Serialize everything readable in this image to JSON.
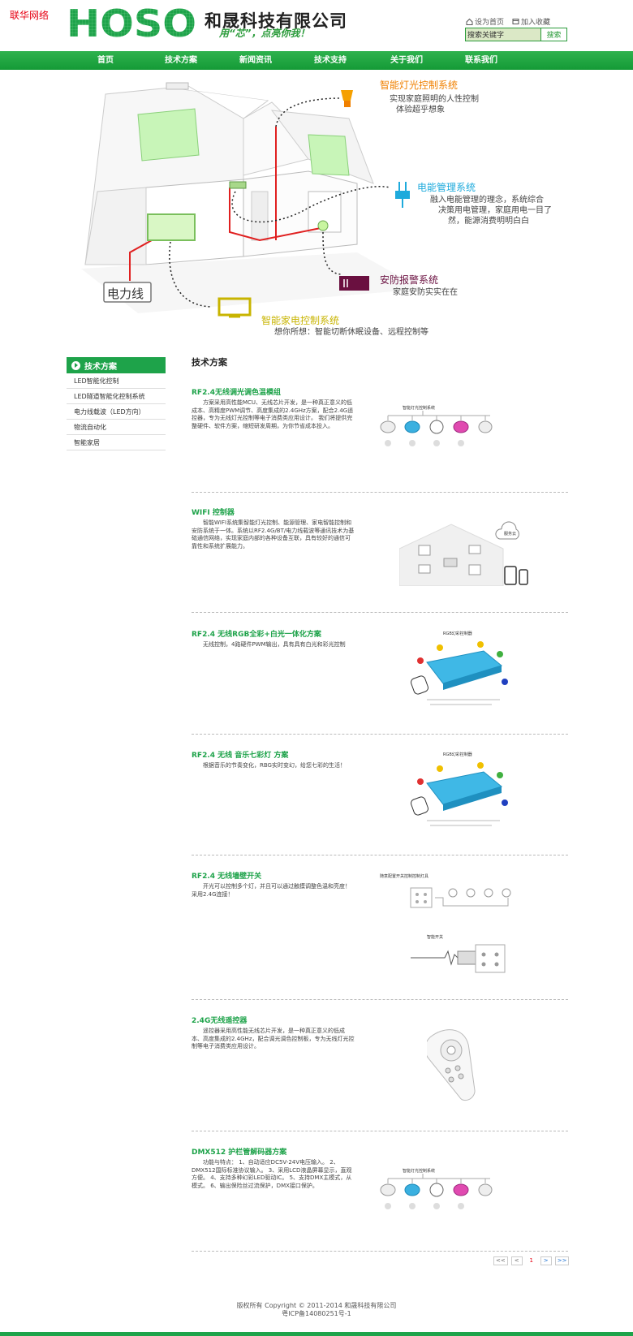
{
  "corner_link": "联华网络",
  "header": {
    "logo_text": "HOSO",
    "company_name": "和晟科技有限公司",
    "slogan": "用“芯”，点亮你我！",
    "set_home": "设为首页",
    "add_favorite": "加入收藏",
    "search_value": "搜索关键字",
    "search_button": "搜索",
    "brand_green": "#1ea34a"
  },
  "nav": [
    "首页",
    "技术方案",
    "新闻资讯",
    "技术支持",
    "关于我们",
    "联系我们"
  ],
  "banner": {
    "power_line": "电力线",
    "lighting": {
      "title": "智能灯光控制系统",
      "lines": [
        "实现家庭照明的人性控制",
        "体验超乎想象"
      ]
    },
    "energy": {
      "title": "电能管理系统",
      "lines": [
        "融入电能管理的理念，系统综合",
        "决策用电管理，家庭用电一目了",
        "然，能源消费明明白白"
      ]
    },
    "security": {
      "title": "安防报警系统",
      "lines": [
        "家庭安防实实在在"
      ]
    },
    "appliance": {
      "title": "智能家电控制系统",
      "lines": [
        "想你所想：智能切断休眠设备、远程控制等"
      ]
    }
  },
  "sidebar": {
    "heading": "技术方案",
    "items": [
      "LED智能化控制",
      "LED隧道智能化控制系统",
      "电力线载波（LED方向）",
      "物流自动化",
      "智能家居"
    ]
  },
  "main_title": "技术方案",
  "solutions": [
    {
      "title": "RF2.4无线调光调色温模组",
      "desc": "方案采用高性能MCU、无线芯片开发，是一种真正意义的低成本、高精度PWM调节、高度集成的2.4GHz方案，配合2.4G遥控器，专为无线灯光控制等电子消费类应用设计。 我们将提供完整硬件、软件方案，缩短研发周期，为你节省成本投入。"
    },
    {
      "title": "WIFI 控制器",
      "desc": "智能WIFI系统集智能灯光控制、能源管理、家电智能控制和安防系统于一体。系统以RF2.4G/BT/电力线载波等通讯技术为基础通信网络，实现家庭内部的各种设备互联，具有较好的通信可靠性和系统扩展能力。"
    },
    {
      "title": "RF2.4 无线RGB全彩+白光一体化方案",
      "desc": "无线控制，4路硬件PWM输出，具有具有白光和彩光控制"
    },
    {
      "title": "RF2.4 无线 音乐七彩灯 方案",
      "desc": "根据音乐的节奏变化，RBG实时变幻，给您七彩的生活！"
    },
    {
      "title": "RF2.4 无线墙壁开关",
      "desc": "开光可以控制多个灯，并且可以通过触摸调整色温和亮度！采用2.4G连接！"
    },
    {
      "title": "2.4G无线遥控器",
      "desc": "遥控器采用高性能无线芯片开发，是一种真正意义的低成本、高度集成的2.4GHz，配合调光调色控制板，专为无线灯光控制等电子消费类应用设计。"
    },
    {
      "title": "DMX512 护栏管解码器方案",
      "desc": "功能与特点： 1、自动适应DC5V-24V电压输入。 2、DMX512国际标准协议输入。 3、采用LCD液晶屏幕显示，直观方便。 4、支持多种幻彩LED驱动IC。 5、支持DMX主模式，从模式。 6、输出保险丝过流保护，DMX接口保护。"
    }
  ],
  "image_captions": {
    "diagram_title": "智能灯光控制系统",
    "rgb_title": "RGB幻彩控制器",
    "wall_switch_title": "随意配置开关控制控制灯具",
    "wall_switch_label": "智能开关",
    "cloud_label": "服务云"
  },
  "pager": [
    "<<",
    "<",
    "1",
    ">",
    ">>"
  ],
  "footer": {
    "copyright": "版权所有 Copyright © 2011-2014  和晟科技有限公司",
    "icp": "粤ICP备14080251号-1"
  }
}
